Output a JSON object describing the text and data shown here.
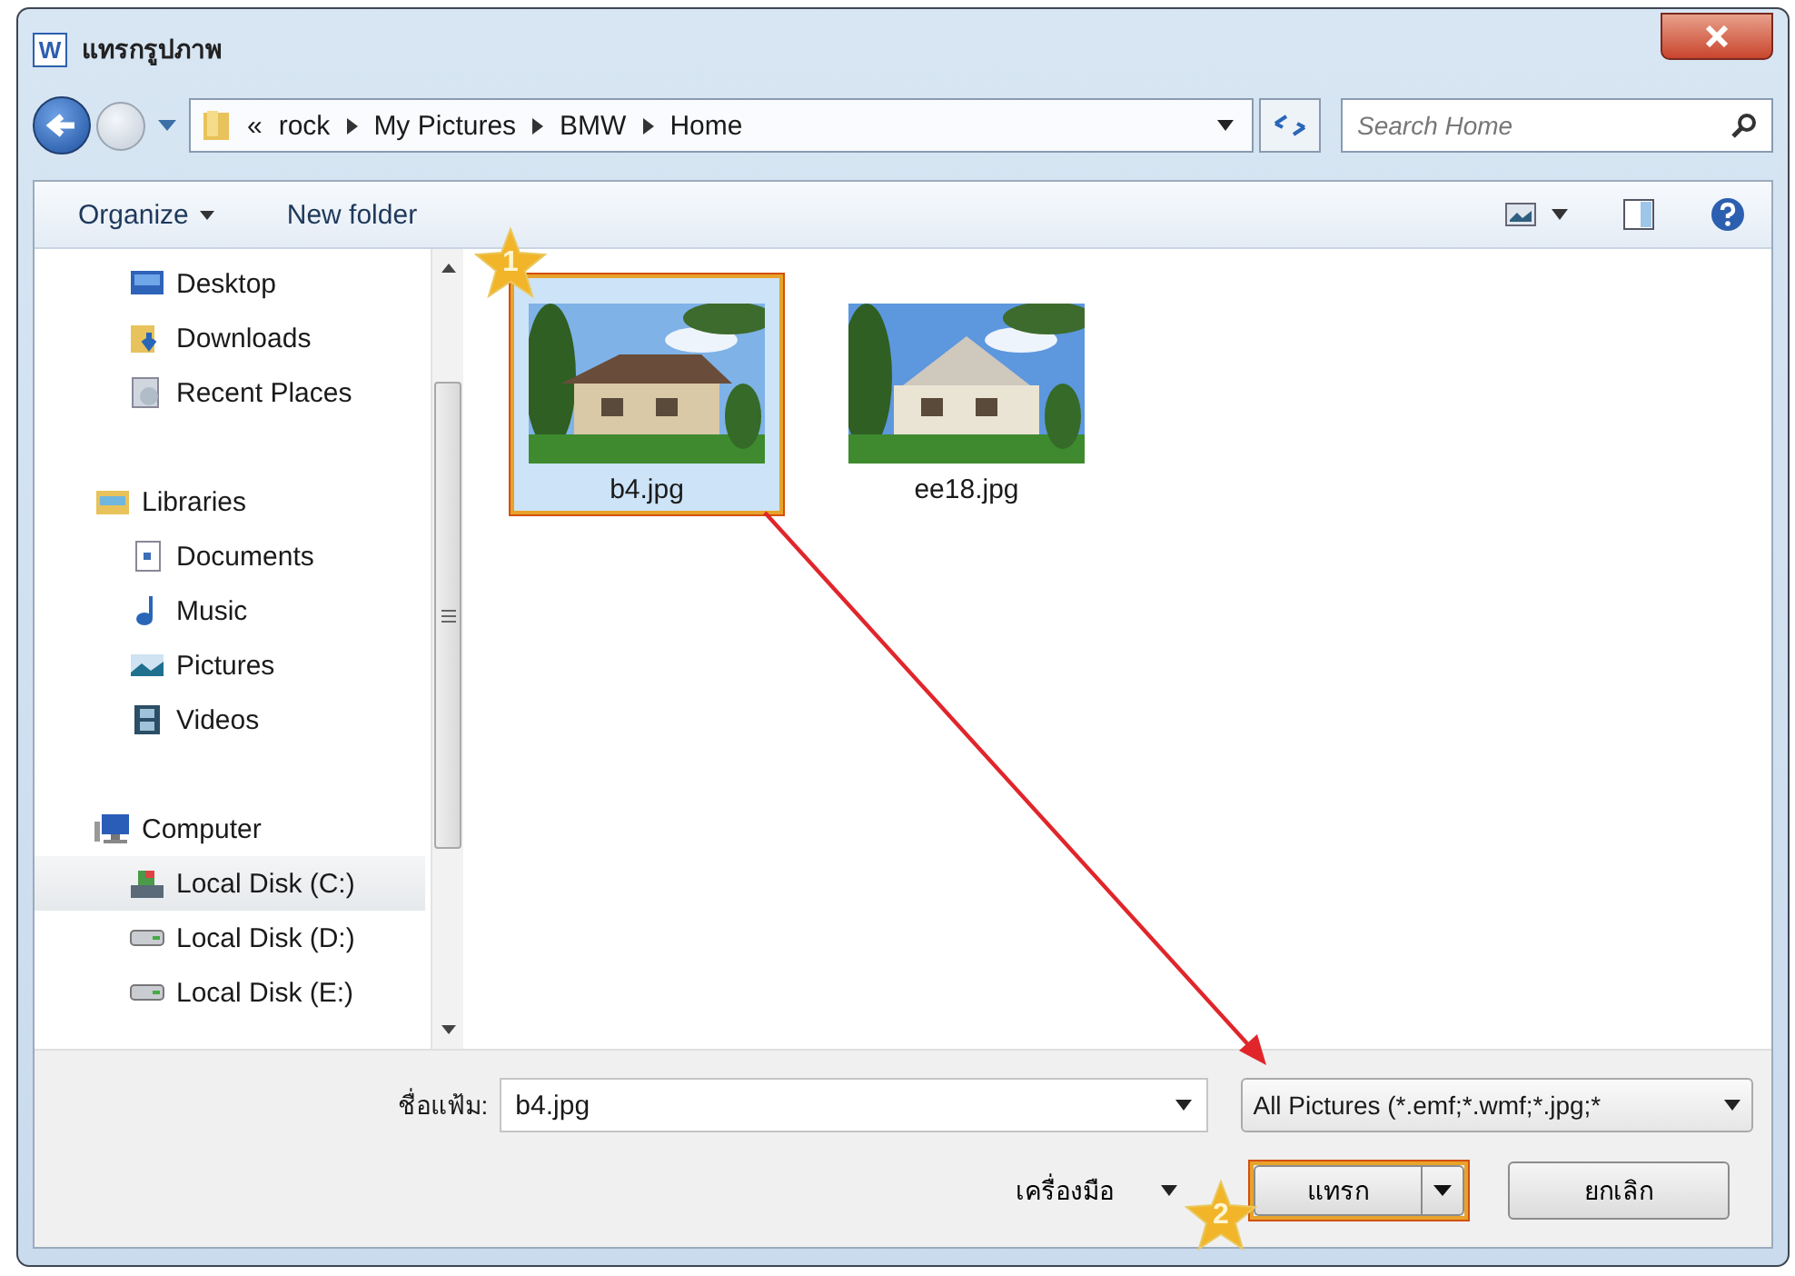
{
  "window": {
    "app_letter": "W",
    "title": "แทรกรูปภาพ"
  },
  "address": {
    "overflow": "«",
    "crumbs": [
      "rock",
      "My Pictures",
      "BMW",
      "Home"
    ]
  },
  "search": {
    "placeholder": "Search Home"
  },
  "toolbar": {
    "items": [
      {
        "label": "Organize",
        "dropdown": true
      },
      {
        "label": "New folder",
        "dropdown": false
      }
    ]
  },
  "sidebar": {
    "groups": [
      {
        "children": [
          {
            "label": "Desktop",
            "kind": "desktop",
            "selected": false
          },
          {
            "label": "Downloads",
            "kind": "downloads",
            "selected": false
          },
          {
            "label": "Recent Places",
            "kind": "recent",
            "selected": false
          }
        ]
      },
      {
        "label": "Libraries",
        "kind": "libraries",
        "children": [
          {
            "label": "Documents",
            "kind": "documents",
            "selected": false
          },
          {
            "label": "Music",
            "kind": "music",
            "selected": false
          },
          {
            "label": "Pictures",
            "kind": "pictures",
            "selected": false
          },
          {
            "label": "Videos",
            "kind": "videos",
            "selected": false
          }
        ]
      },
      {
        "label": "Computer",
        "kind": "computer",
        "children": [
          {
            "label": "Local Disk (C:)",
            "kind": "system-disk",
            "selected": true
          },
          {
            "label": "Local Disk (D:)",
            "kind": "disk",
            "selected": false
          },
          {
            "label": "Local Disk (E:)",
            "kind": "disk",
            "selected": false
          }
        ]
      }
    ]
  },
  "files": [
    {
      "name": "b4.jpg",
      "kind": "picture",
      "selected": true,
      "step": "1"
    },
    {
      "name": "ee18.jpg",
      "kind": "picture",
      "selected": false
    }
  ],
  "footer": {
    "filename_label": "ชื่อแฟ้ม:",
    "filename": "b4.jpg",
    "filter": "All Pictures (*.emf;*.wmf;*.jpg;*",
    "tools": "เครื่องมือ",
    "insert": {
      "label": "แทรก",
      "step": "2"
    },
    "cancel": "ยกเลิก"
  }
}
